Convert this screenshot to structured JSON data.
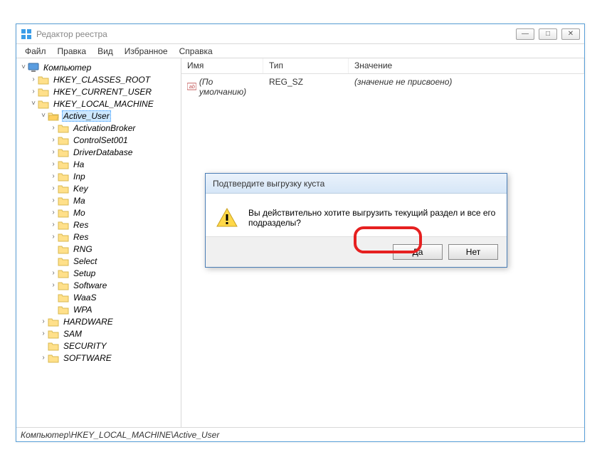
{
  "window": {
    "title": "Редактор реестра",
    "controls": {
      "min": "—",
      "max": "□",
      "close": "✕"
    }
  },
  "menu": [
    "Файл",
    "Правка",
    "Вид",
    "Избранное",
    "Справка"
  ],
  "columns": {
    "name": "Имя",
    "type": "Тип",
    "value": "Значение"
  },
  "row": {
    "name": "(По умолчанию)",
    "type": "REG_SZ",
    "value": "(значение не присвоено)"
  },
  "statusbar": "Компьютер\\HKEY_LOCAL_MACHINE\\Active_User",
  "tree": {
    "root": "Компьютер",
    "k1": "HKEY_CLASSES_ROOT",
    "k2": "HKEY_CURRENT_USER",
    "k3": "HKEY_LOCAL_MACHINE",
    "au": "Active_User",
    "children": [
      "ActivationBroker",
      "ControlSet001",
      "DriverDatabase",
      "Ha",
      "Inp",
      "Key",
      "Ma",
      "Mo",
      "Res",
      "Res",
      "RNG",
      "Select",
      "Setup",
      "Software",
      "WaaS",
      "WPA"
    ],
    "k4": "HARDWARE",
    "k5": "SAM",
    "k6": "SECURITY",
    "k7": "SOFTWARE"
  },
  "dialog": {
    "title": "Подтвердите выгрузку куста",
    "message": "Вы действительно хотите выгрузить текущий раздел и все его подразделы?",
    "yes": "Да",
    "no": "Нет"
  }
}
